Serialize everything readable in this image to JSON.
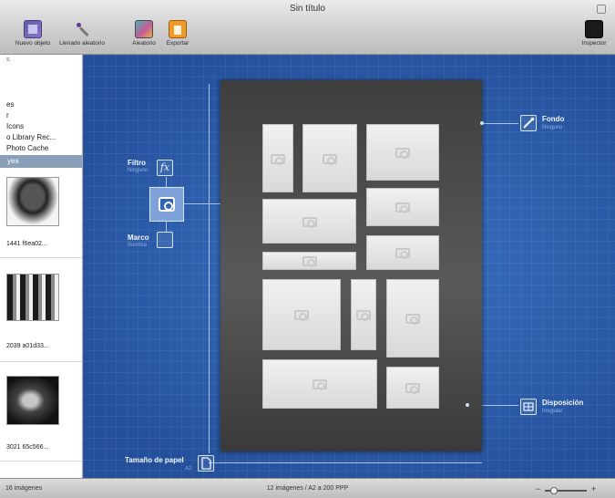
{
  "window": {
    "title": "Sin título"
  },
  "toolbar": {
    "new_label": "Nuevo objeto",
    "random_fill_label": "Llenado aleatorio",
    "random_label": "Aleatorio",
    "export_label": "Exportar",
    "inspector_label": "Inspector"
  },
  "sidebar": {
    "lines": [
      "s",
      "es",
      "r",
      "Icons",
      "o Library Rec...",
      "Photo Cache"
    ],
    "selected": "yes",
    "thumbnails": [
      {
        "caption": "1441 f6ea02..."
      },
      {
        "caption": "2039 a01d33..."
      },
      {
        "caption": "3021 65c566..."
      }
    ]
  },
  "canvas": {
    "filter": {
      "label": "Filtro",
      "sub": "Ninguno",
      "icon": "fx-icon"
    },
    "frame": {
      "label": "Marco",
      "sub": "Sombra"
    },
    "background": {
      "label": "Fondo",
      "sub": "Ninguno"
    },
    "layout": {
      "label": "Disposición",
      "sub": "Irregular"
    },
    "paper_size": {
      "label": "Tamaño de papel",
      "sub": "A2"
    }
  },
  "statusbar": {
    "left": "16 imágenes",
    "center": "12 imágenes / A2 a 200 PPP"
  }
}
